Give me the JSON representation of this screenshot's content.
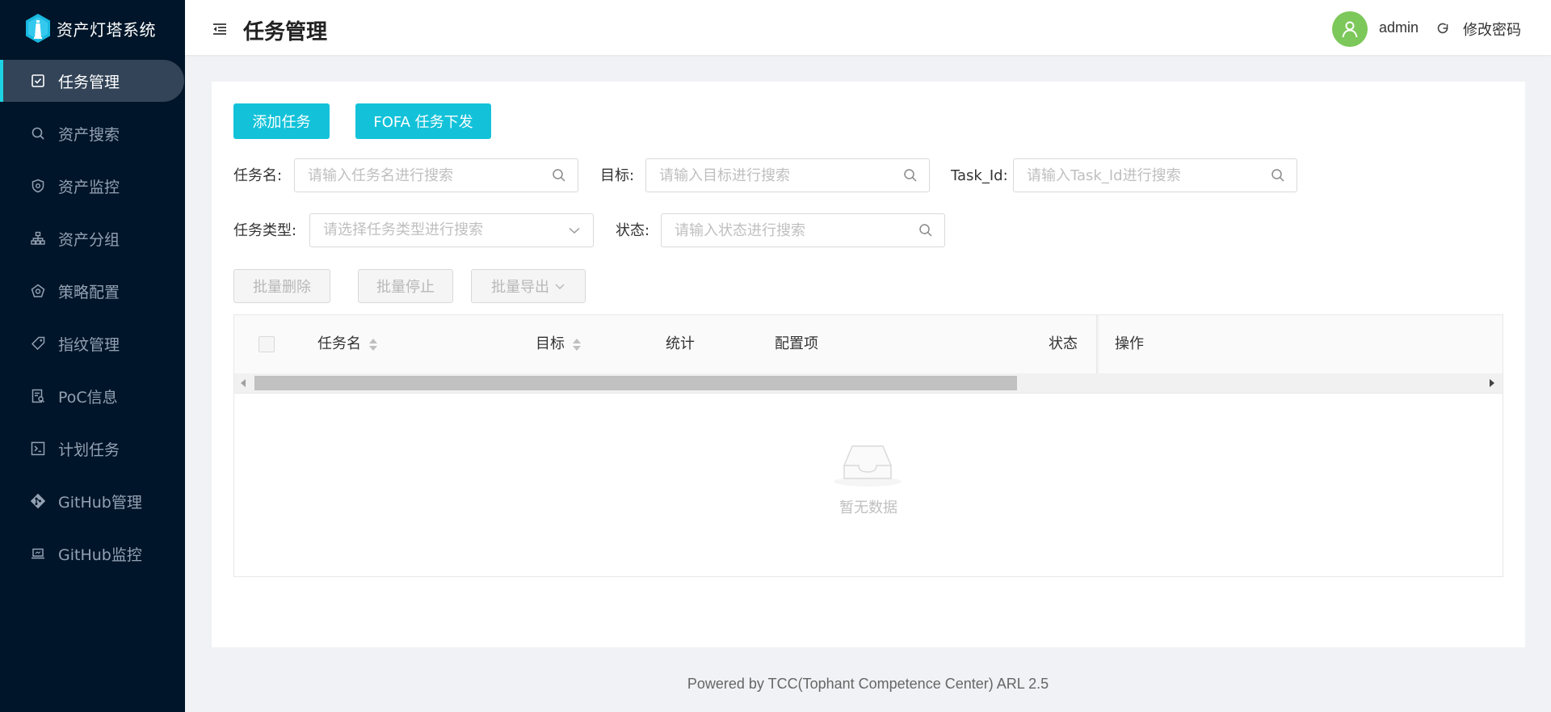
{
  "app": {
    "title": "资产灯塔系统"
  },
  "sidebar": {
    "items": [
      {
        "label": "任务管理",
        "icon": "task-icon",
        "active": true
      },
      {
        "label": "资产搜索",
        "icon": "search-icon"
      },
      {
        "label": "资产监控",
        "icon": "monitor-shield-icon"
      },
      {
        "label": "资产分组",
        "icon": "group-tree-icon"
      },
      {
        "label": "策略配置",
        "icon": "policy-icon"
      },
      {
        "label": "指纹管理",
        "icon": "tag-icon"
      },
      {
        "label": "PoC信息",
        "icon": "poc-doc-icon"
      },
      {
        "label": "计划任务",
        "icon": "terminal-icon"
      },
      {
        "label": "GitHub管理",
        "icon": "git-icon"
      },
      {
        "label": "GitHub监控",
        "icon": "laptop-icon"
      }
    ]
  },
  "header": {
    "title": "任务管理",
    "username": "admin",
    "change_password": "修改密码"
  },
  "actions": {
    "add_task": "添加任务",
    "fofa_task": "FOFA 任务下发"
  },
  "filters": {
    "task_name": {
      "label": "任务名:",
      "placeholder": "请输入任务名进行搜索"
    },
    "target": {
      "label": "目标:",
      "placeholder": "请输入目标进行搜索"
    },
    "task_id": {
      "label": "Task_Id:",
      "placeholder": "请输入Task_Id进行搜索"
    },
    "task_type": {
      "label": "任务类型:",
      "placeholder": "请选择任务类型进行搜索"
    },
    "status": {
      "label": "状态:",
      "placeholder": "请输入状态进行搜索"
    }
  },
  "batch": {
    "delete": "批量删除",
    "stop": "批量停止",
    "export": "批量导出"
  },
  "table": {
    "columns": [
      "任务名",
      "目标",
      "统计",
      "配置项",
      "状态",
      "操作"
    ],
    "empty_text": "暂无数据"
  },
  "footer": {
    "text": "Powered by TCC(Tophant Competence Center) ARL 2.5"
  },
  "colors": {
    "primary": "#13c2d9",
    "sidebar_bg": "#001529",
    "active_bar": "#1dd3e3",
    "avatar": "#7cc85a"
  }
}
